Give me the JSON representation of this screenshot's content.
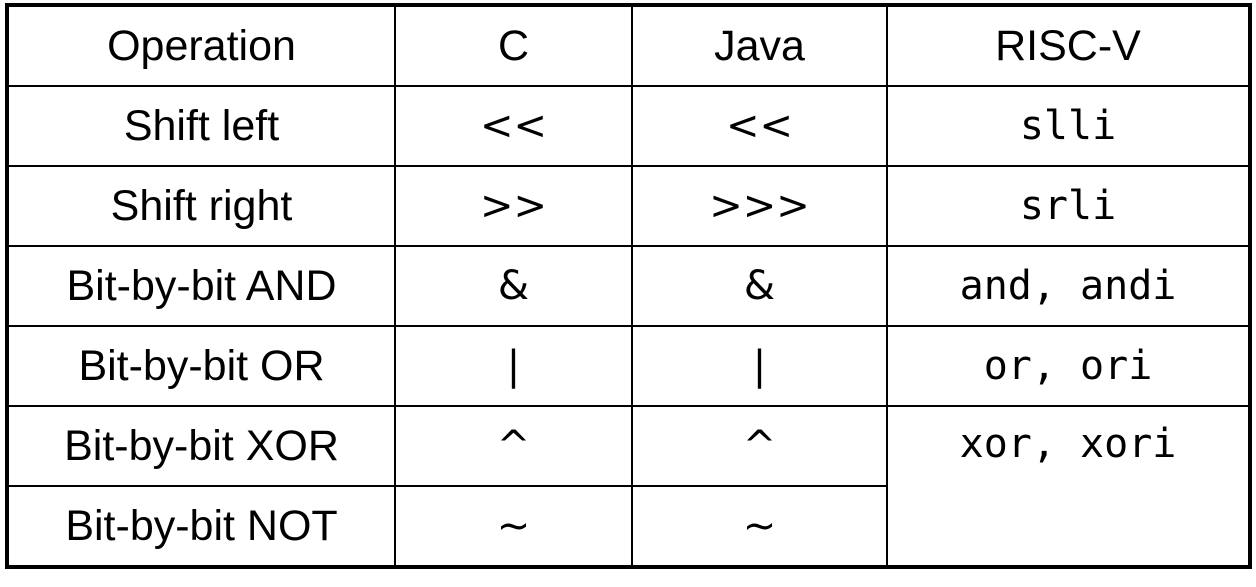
{
  "headers": [
    "Operation",
    "C",
    "Java",
    "RISC-V"
  ],
  "rows": [
    {
      "operation": "Shift left",
      "c": "<<",
      "java": "<<",
      "riscv": "slli"
    },
    {
      "operation": "Shift right",
      "c": ">>",
      "java": ">>>",
      "riscv": "srli"
    },
    {
      "operation": "Bit-by-bit AND",
      "c": "&",
      "java": "&",
      "riscv": "and, andi"
    },
    {
      "operation": "Bit-by-bit OR",
      "c": "|",
      "java": "|",
      "riscv": "or, ori"
    },
    {
      "operation": "Bit-by-bit XOR",
      "c": "^",
      "java": "^",
      "riscv": "xor, xori"
    },
    {
      "operation": "Bit-by-bit NOT",
      "c": "~",
      "java": "~"
    }
  ]
}
